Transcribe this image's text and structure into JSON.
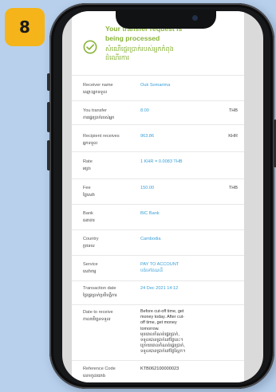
{
  "step_number": "8",
  "banner": {
    "title_line1": "Your transfer request is",
    "title_line2": "being processed",
    "khmer_line1": "សំណើផ្ទេរប្រាក់របស់អ្នកកំពុង",
    "khmer_line2": "ដំណើរការ",
    "icon": "check-circle-icon",
    "color": "#8ab43a"
  },
  "rows": {
    "receiver_name": {
      "label": "Receiver name",
      "label_km": "ឈ្មោះអ្នកទទួល",
      "value": "Ouk Somarima"
    },
    "you_transfer": {
      "label": "You transfer",
      "label_km": "ការផ្ទេរប្រាក់របស់អ្នក",
      "value": "8.00",
      "unit": "THB"
    },
    "recipient_receives": {
      "label": "Recipient receives",
      "label_km": "អ្នកទទួល",
      "value": "963.86",
      "unit": "KHR"
    },
    "rate": {
      "label": "Rate",
      "label_km": "អត្រា",
      "value": "1 KHR = 0.0083 THB"
    },
    "fee": {
      "label": "Fee",
      "label_km": "ថ្លៃសេវា",
      "value": "150.00",
      "unit": "THB"
    },
    "bank": {
      "label": "Bank",
      "label_km": "ធនាគារ",
      "value": "BIC Bank"
    },
    "country": {
      "label": "Country",
      "label_km": "ប្រទេស",
      "value": "Cambodia"
    },
    "service": {
      "label": "Service",
      "label_km": "សេវាកម្ម",
      "value": "PAY TO ACCOUNT",
      "value_km": "បង់ទៅគណនី"
    },
    "transaction_date": {
      "label": "Transaction date",
      "label_km": "ថ្ងៃផ្ទេរប្រាក់ប្រតិបត្តិការ",
      "value": "24 Dec 2021 14:12"
    },
    "date_to_receive": {
      "label": "Date to receive",
      "label_km": "កាលបរិច្ឆេទទទួល",
      "lines": [
        "Before cut-off time, get",
        "money today. After cut-",
        "off time, get money",
        "tomorrow.",
        "មុនពេលកំណត់ផ្ទេរប្រាក់,",
        "ទទួលបានប្រាក់នៅថ្ងៃនេះ។",
        "ក្រោយពេលកំណត់ផ្ទេរប្រាក់,",
        "ទទួលបានប្រាក់នៅថ្ងៃស្អែក។"
      ]
    },
    "reference_code": {
      "label": "Reference Code",
      "label_km": "លេខកូដយោង",
      "value": "KTB062100000023"
    }
  },
  "colors": {
    "accent_green": "#8ab43a",
    "value_blue": "#3aa0d8",
    "badge": "#f4b41a",
    "background": "#b8d0ec"
  }
}
